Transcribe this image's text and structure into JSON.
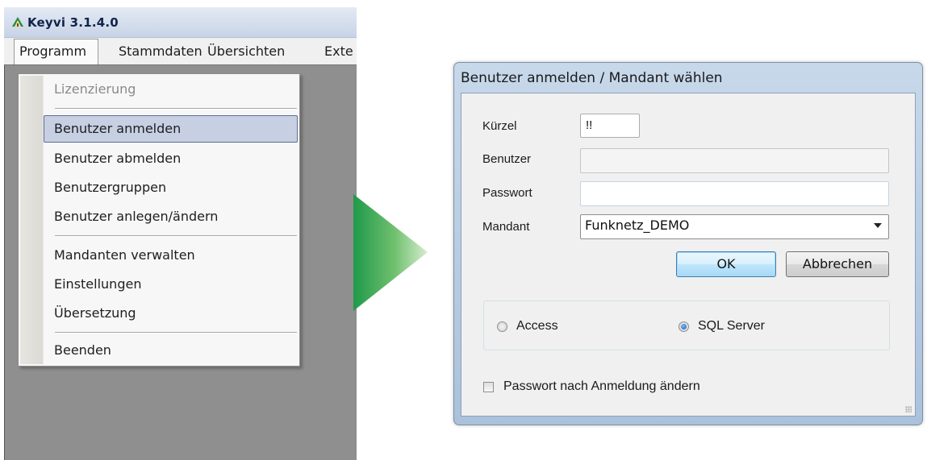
{
  "app": {
    "title": "Keyvi 3.1.4.0",
    "menu": [
      "Programm",
      "Stammdaten",
      "Übersichten",
      "Exte"
    ]
  },
  "dropdown": {
    "items": [
      {
        "label": "Lizenzierung",
        "disabled": true
      },
      {
        "label": "Benutzer anmelden",
        "highlighted": true
      },
      {
        "label": "Benutzer abmelden"
      },
      {
        "label": "Benutzergruppen"
      },
      {
        "label": "Benutzer anlegen/ändern"
      },
      {
        "label": "Mandanten verwalten"
      },
      {
        "label": "Einstellungen"
      },
      {
        "label": "Übersetzung"
      },
      {
        "label": "Beenden"
      }
    ]
  },
  "dialog": {
    "title": "Benutzer anmelden / Mandant wählen",
    "kuerzel_label": "Kürzel",
    "kuerzel_value": "!!",
    "benutzer_label": "Benutzer",
    "benutzer_value": "",
    "passwort_label": "Passwort",
    "passwort_value": "",
    "mandant_label": "Mandant",
    "mandant_value": "Funknetz_DEMO",
    "ok_label": "OK",
    "cancel_label": "Abbrechen",
    "radio_access_label": "Access",
    "radio_sql_label": "SQL Server",
    "selected_backend": "SQL Server",
    "change_password_label": "Passwort nach Anmeldung ändern",
    "change_password_checked": false
  },
  "colors": {
    "arrow_start": "#1f9a4a",
    "arrow_end": "#d7ecd0",
    "highlight": "#c7cfe3",
    "dialog_frame": "#b7cbe2"
  }
}
